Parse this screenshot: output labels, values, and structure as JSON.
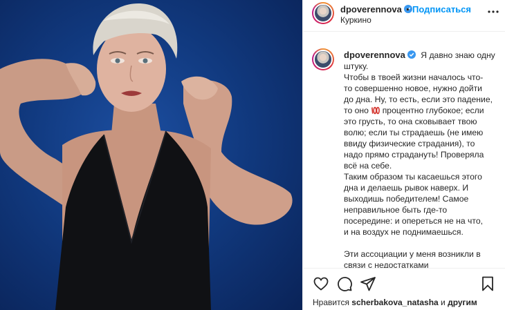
{
  "post": {
    "author": {
      "username": "dpoverennova",
      "verified": true,
      "location": "Куркино"
    },
    "header": {
      "separator": "•",
      "follow_label": "Подписаться"
    },
    "caption": {
      "lines": [
        "Я давно знаю одну",
        "штуку.",
        "Чтобы в твоей жизни началось что-",
        "то совершенно новое, нужно дойти",
        "до дна. Ну, то есть, если это падение,"
      ],
      "line_emoji_before": "то оно",
      "line_emoji_after": "процентно глубокое; если",
      "lines_2": [
        "это грусть, то она сковывает твою",
        "волю; если ты страдаешь (не имею",
        "ввиду физические страдания), то",
        "надо прямо страдануть! Проверяла",
        "всё на себе.",
        "Таким образом ты касаешься этого",
        "дна и делаешь рывок наверх. И",
        "выходишь победителем! Самое",
        "неправильное быть где-то",
        "посередине: и опереться не на что,",
        "и на воздух не поднимаешься."
      ],
      "lines_3": [
        "Эти ассоциации у меня возникли в",
        "связи с недостатками"
      ]
    },
    "likes": {
      "prefix": "Нравится",
      "user": "scherbakova_natasha",
      "conj": "и",
      "others": "другим"
    },
    "icons": {
      "like": "heart-icon",
      "comment": "comment-icon",
      "share": "share-icon",
      "save": "bookmark-icon",
      "more": "more-options-icon",
      "verified": "verified-badge-icon",
      "emoji": "hundred-points-icon"
    },
    "colors": {
      "follow": "#0095f6",
      "verified": "#3897f0",
      "text": "#262626",
      "photo_background": "#113a80"
    }
  }
}
